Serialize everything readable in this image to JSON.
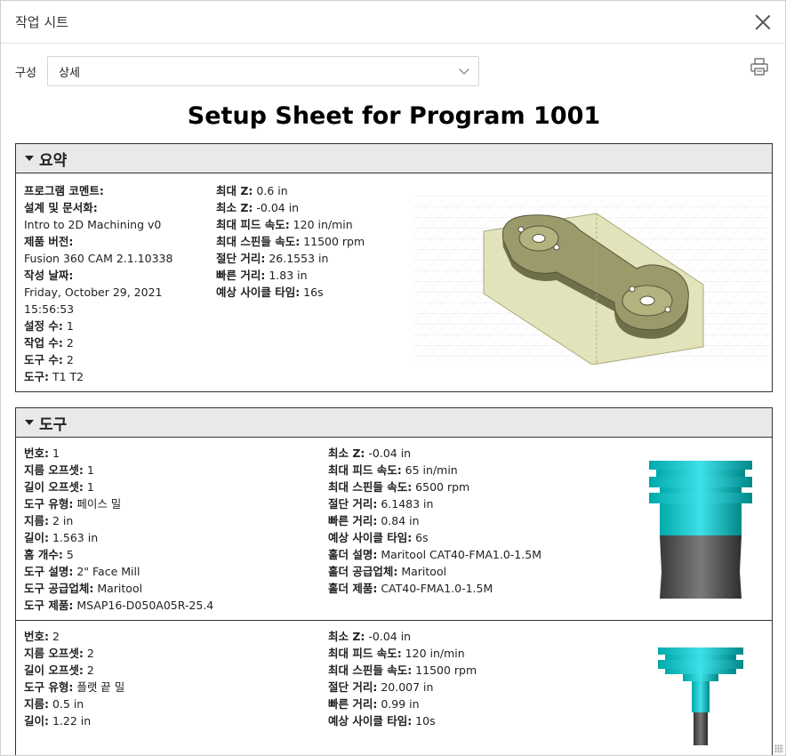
{
  "dialog": {
    "title": "작업 시트"
  },
  "config": {
    "label": "구성",
    "value": "상세"
  },
  "sheet": {
    "title": "Setup Sheet for Program 1001"
  },
  "summary": {
    "heading": "요약",
    "left": [
      {
        "key": "프로그램 코멘트:",
        "value": ""
      },
      {
        "key": "설계 및 문서화:",
        "value": ""
      },
      {
        "key": "",
        "value": "Intro to 2D Machining v0"
      },
      {
        "key": "제품 버전:",
        "value": ""
      },
      {
        "key": "",
        "value": "Fusion 360 CAM 2.1.10338"
      },
      {
        "key": "작성 날짜:",
        "value": ""
      },
      {
        "key": "",
        "value": "Friday, October 29, 2021"
      },
      {
        "key": "",
        "value": "15:56:53"
      },
      {
        "key": "설정 수:",
        "value": " 1"
      },
      {
        "key": "작업 수:",
        "value": " 2"
      },
      {
        "key": "도구 수:",
        "value": " 2"
      },
      {
        "key": "도구:",
        "value": " T1 T2"
      }
    ],
    "right": [
      {
        "key": "최대 Z:",
        "value": " 0.6 in"
      },
      {
        "key": "최소 Z:",
        "value": " -0.04 in"
      },
      {
        "key": "최대 피드 속도:",
        "value": " 120 in/min"
      },
      {
        "key": "최대 스핀들 속도:",
        "value": " 11500 rpm"
      },
      {
        "key": "절단 거리:",
        "value": " 26.1553 in"
      },
      {
        "key": "빠른 거리:",
        "value": " 1.83 in"
      },
      {
        "key": "예상 사이클 타임:",
        "value": " 16s"
      }
    ]
  },
  "tools": {
    "heading": "도구",
    "items": [
      {
        "left": [
          {
            "key": "번호:",
            "value": " 1"
          },
          {
            "key": "지름 오프셋:",
            "value": " 1"
          },
          {
            "key": "길이 오프셋:",
            "value": " 1"
          },
          {
            "key": "도구 유형:",
            "value": " 페이스 밀"
          },
          {
            "key": "지름:",
            "value": " 2 in"
          },
          {
            "key": "길이:",
            "value": " 1.563 in"
          },
          {
            "key": "홈 개수:",
            "value": " 5"
          },
          {
            "key": "도구 설명:",
            "value": " 2\" Face Mill"
          },
          {
            "key": "도구 공급업체:",
            "value": " Maritool"
          },
          {
            "key": "도구 제품:",
            "value": " MSAP16-D050A05R-25.4"
          }
        ],
        "right": [
          {
            "key": "최소 Z:",
            "value": " -0.04 in"
          },
          {
            "key": "최대 피드 속도:",
            "value": " 65 in/min"
          },
          {
            "key": "최대 스핀들 속도:",
            "value": " 6500 rpm"
          },
          {
            "key": "절단 거리:",
            "value": " 6.1483 in"
          },
          {
            "key": "빠른 거리:",
            "value": " 0.84 in"
          },
          {
            "key": "예상 사이클 타임:",
            "value": " 6s"
          },
          {
            "key": "홀더 설명:",
            "value": " Maritool CAT40-FMA1.0-1.5M"
          },
          {
            "key": "홀더 공급업체:",
            "value": " Maritool"
          },
          {
            "key": "홀더 제품:",
            "value": " CAT40-FMA1.0-1.5M"
          }
        ]
      },
      {
        "left": [
          {
            "key": "번호:",
            "value": " 2"
          },
          {
            "key": "지름 오프셋:",
            "value": " 2"
          },
          {
            "key": "길이 오프셋:",
            "value": " 2"
          },
          {
            "key": "도구 유형:",
            "value": " 플랫 끝 밀"
          },
          {
            "key": "지름:",
            "value": " 0.5 in"
          },
          {
            "key": "길이:",
            "value": " 1.22 in"
          }
        ],
        "right": [
          {
            "key": "최소 Z:",
            "value": " -0.04 in"
          },
          {
            "key": "최대 피드 속도:",
            "value": " 120 in/min"
          },
          {
            "key": "최대 스핀들 속도:",
            "value": " 11500 rpm"
          },
          {
            "key": "절단 거리:",
            "value": " 20.007 in"
          },
          {
            "key": "빠른 거리:",
            "value": " 0.99 in"
          },
          {
            "key": "예상 사이클 타임:",
            "value": " 10s"
          }
        ]
      }
    ]
  },
  "icons": {
    "close": "close-icon",
    "print": "printer-icon",
    "dropdown": "chevron-down-icon",
    "collapse": "triangle-down-icon"
  }
}
